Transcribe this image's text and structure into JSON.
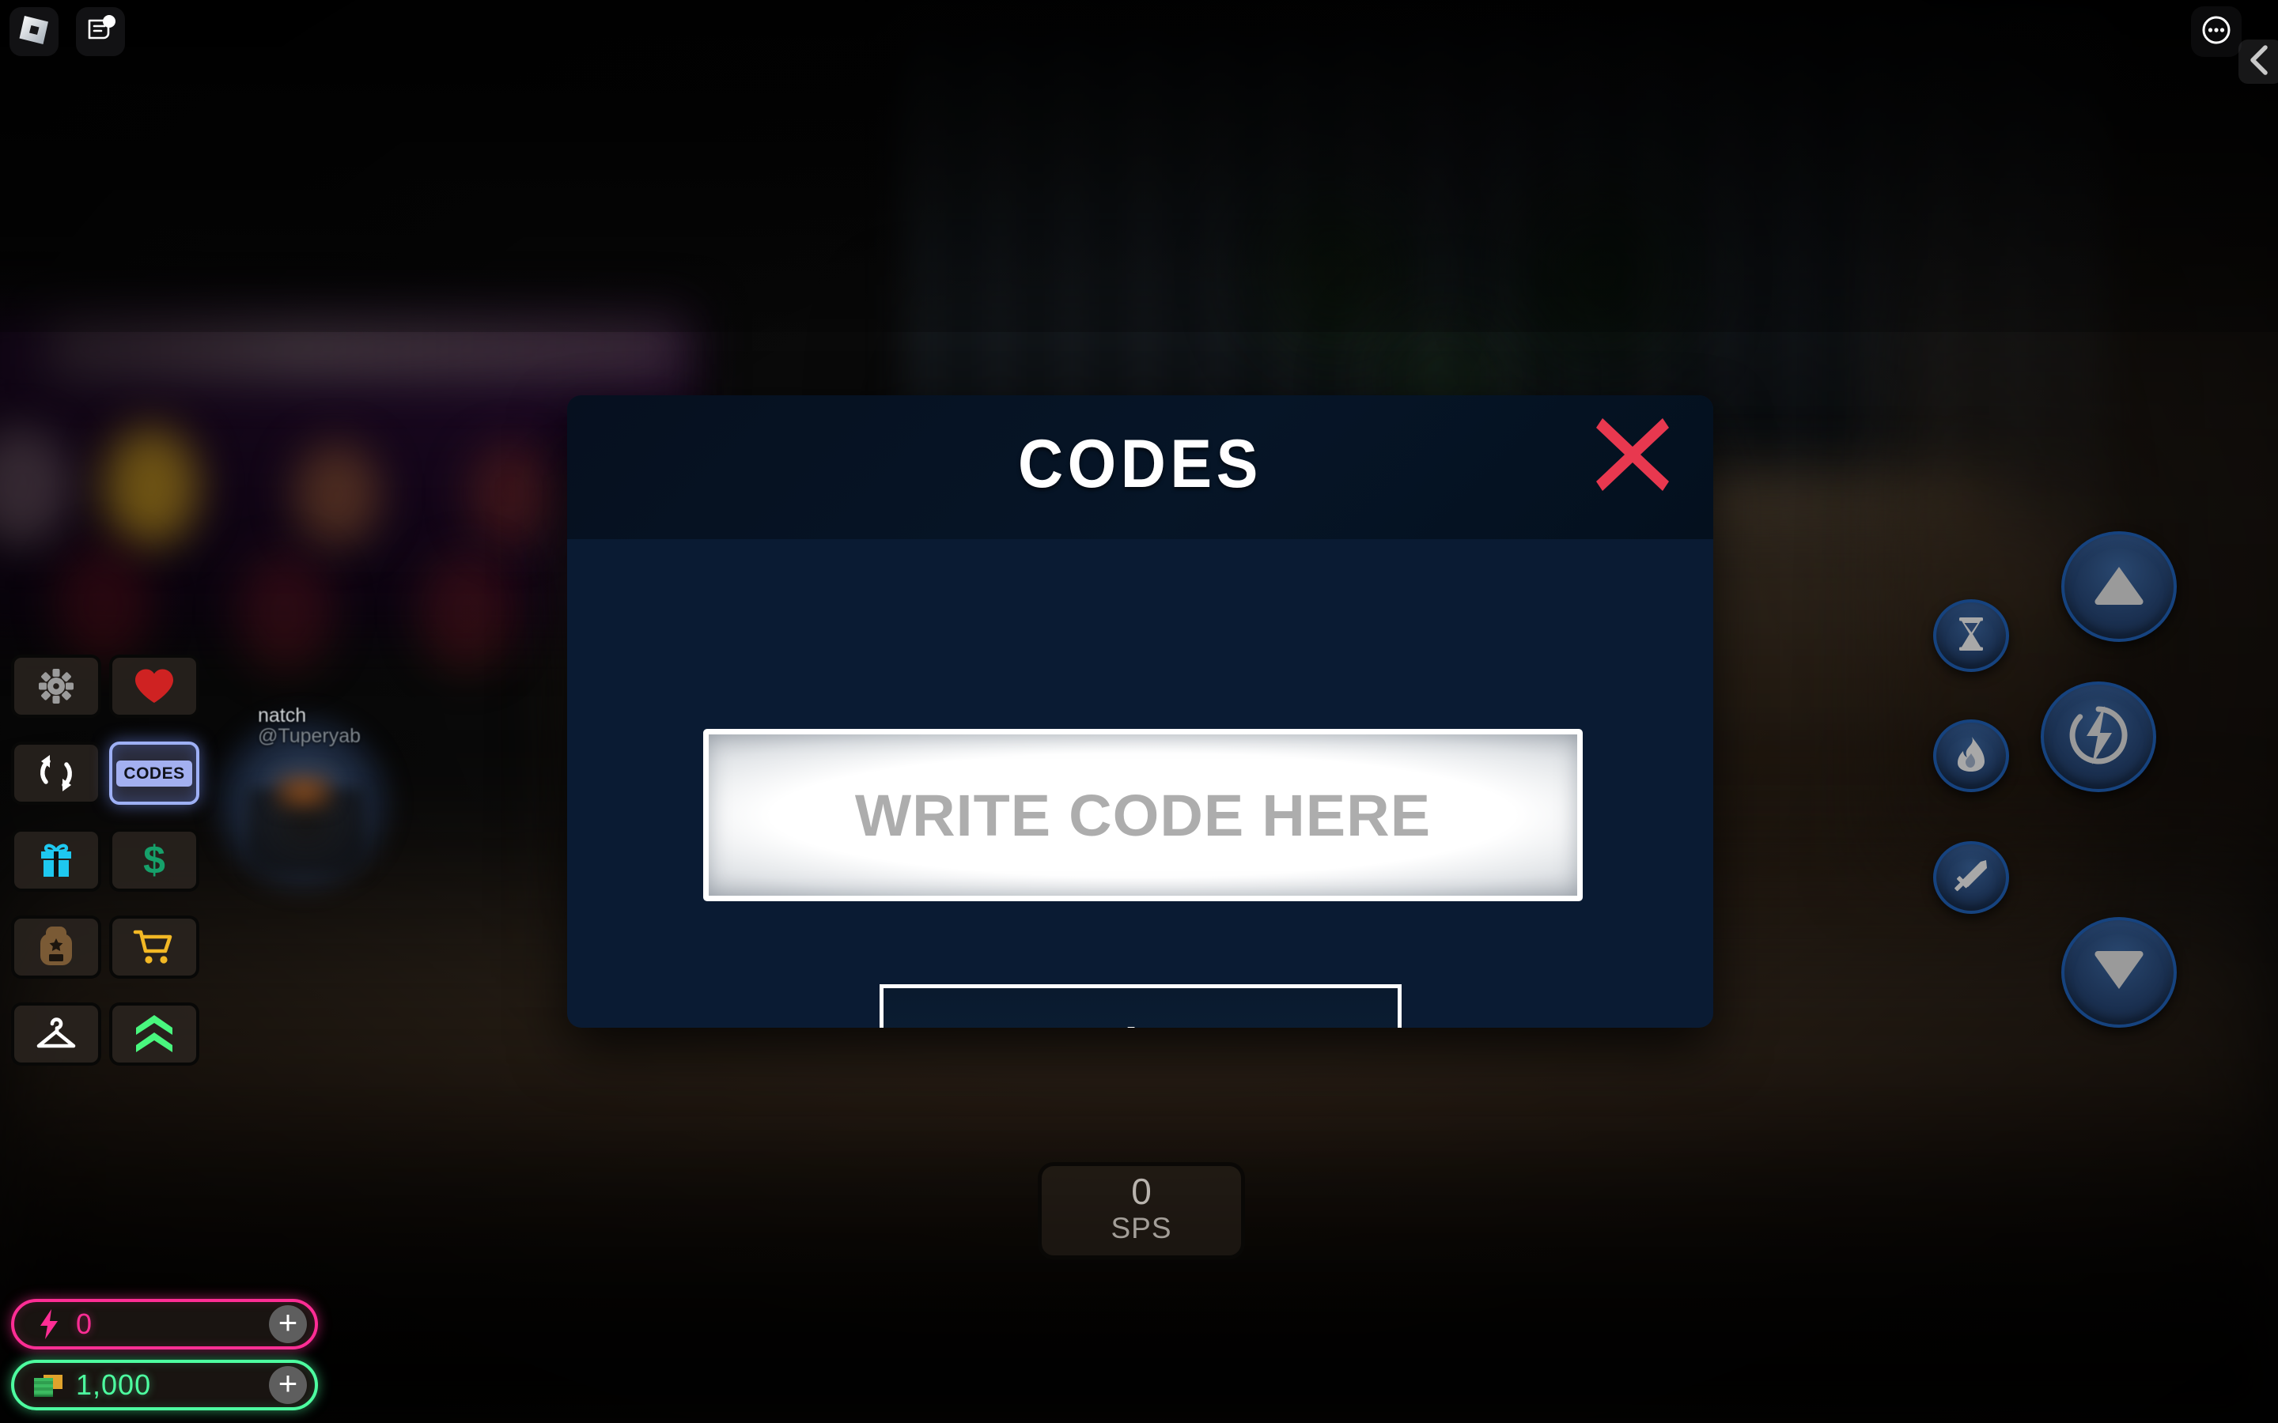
{
  "topbar": {
    "roblox_logo_icon": "roblox-logo-icon",
    "chat_icon": "chat-icon",
    "menu_icon": "more-options-icon",
    "collapse_icon": "chevron-left-icon"
  },
  "avatar": {
    "display_name": "natch",
    "username": "@Tuperyab"
  },
  "sidebar": {
    "items": [
      {
        "name": "settings",
        "icon": "gear-icon",
        "label": "",
        "active": false
      },
      {
        "name": "favorite",
        "icon": "heart-icon",
        "label": "",
        "active": false
      },
      {
        "name": "rebirth",
        "icon": "refresh-icon",
        "label": "",
        "active": false
      },
      {
        "name": "codes",
        "icon": "codes-icon",
        "label": "CODES",
        "active": true
      },
      {
        "name": "gifts",
        "icon": "gift-icon",
        "label": "",
        "active": false
      },
      {
        "name": "cash",
        "icon": "dollar-icon",
        "label": "",
        "active": false
      },
      {
        "name": "backpack",
        "icon": "backpack-icon",
        "label": "",
        "active": false
      },
      {
        "name": "shop",
        "icon": "shopping-cart-icon",
        "label": "",
        "active": false
      },
      {
        "name": "wardrobe",
        "icon": "clothes-hanger-icon",
        "label": "",
        "active": false
      },
      {
        "name": "upgrade",
        "icon": "double-chevron-up-icon",
        "label": "",
        "active": false
      }
    ]
  },
  "currency": {
    "energy": {
      "icon": "lightning-bolt-icon",
      "value": "0",
      "add_label": "+",
      "color": "#ff2d95"
    },
    "cash": {
      "icon": "money-stack-icon",
      "value": "1,000",
      "add_label": "+",
      "color": "#4dffa0"
    }
  },
  "sps_counter": {
    "value": "0",
    "label": "SPS"
  },
  "action_buttons": [
    {
      "name": "timer",
      "icon": "hourglass-icon"
    },
    {
      "name": "fire",
      "icon": "flame-icon"
    },
    {
      "name": "sword",
      "icon": "sword-icon"
    },
    {
      "name": "jump-up",
      "icon": "triangle-up-icon"
    },
    {
      "name": "sprint",
      "icon": "lightning-circle-icon"
    },
    {
      "name": "jump-down",
      "icon": "triangle-down-icon"
    }
  ],
  "codes_modal": {
    "title": "CODES",
    "close_icon": "close-x-icon",
    "input_placeholder": "WRITE CODE HERE",
    "input_value": "",
    "redeem_label": "Redeem",
    "accent_close_color": "#e8384f",
    "panel_color": "#0a1b33",
    "header_color": "#06101f"
  }
}
